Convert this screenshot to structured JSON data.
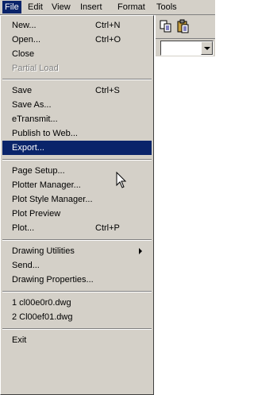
{
  "menubar": {
    "items": [
      "File",
      "Edit",
      "View",
      "Insert",
      "Format",
      "Tools"
    ],
    "active": "File"
  },
  "file_menu": {
    "items": [
      {
        "label": "New...",
        "shortcut": "Ctrl+N"
      },
      {
        "label": "Open...",
        "shortcut": "Ctrl+O"
      },
      {
        "label": "Close",
        "shortcut": ""
      },
      {
        "label": "Partial Load",
        "shortcut": "",
        "disabled": true
      },
      {
        "label": "Save",
        "shortcut": "Ctrl+S"
      },
      {
        "label": "Save As...",
        "shortcut": ""
      },
      {
        "label": "eTransmit...",
        "shortcut": ""
      },
      {
        "label": "Publish to Web...",
        "shortcut": ""
      },
      {
        "label": "Export...",
        "shortcut": "",
        "selected": true
      },
      {
        "label": "Page Setup...",
        "shortcut": ""
      },
      {
        "label": "Plotter Manager...",
        "shortcut": ""
      },
      {
        "label": "Plot Style Manager...",
        "shortcut": ""
      },
      {
        "label": "Plot Preview",
        "shortcut": ""
      },
      {
        "label": "Plot...",
        "shortcut": "Ctrl+P"
      },
      {
        "label": "Drawing Utilities",
        "shortcut": "",
        "submenu": true
      },
      {
        "label": "Send...",
        "shortcut": ""
      },
      {
        "label": "Drawing Properties...",
        "shortcut": ""
      },
      {
        "label": "1 cl00e0r0.dwg",
        "shortcut": ""
      },
      {
        "label": "2 Cl00ef01.dwg",
        "shortcut": ""
      },
      {
        "label": "Exit",
        "shortcut": ""
      }
    ]
  },
  "toolbar": {
    "icons": [
      "copy-icon",
      "paste-icon"
    ]
  },
  "colors": {
    "menu_face": "#d4d0c8",
    "highlight": "#0a246a",
    "disabled_text": "#808080"
  }
}
